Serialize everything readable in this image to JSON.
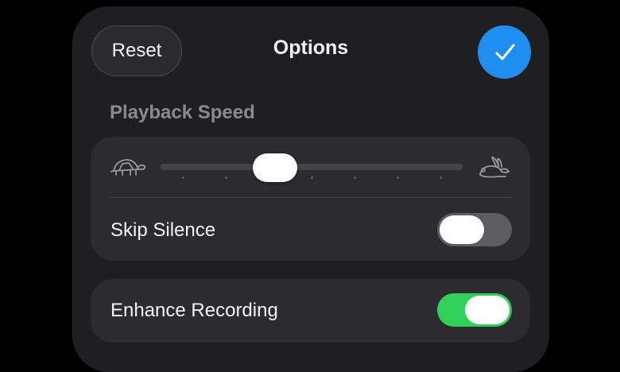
{
  "header": {
    "reset_label": "Reset",
    "title": "Options",
    "confirm_icon": "checkmark-icon",
    "confirm_color": "#1e8ff0"
  },
  "playback": {
    "section_label": "Playback Speed",
    "slow_icon": "tortoise-icon",
    "fast_icon": "hare-icon",
    "speed_stops": 7,
    "selected_stop": 2
  },
  "skip_silence": {
    "label": "Skip Silence",
    "enabled": false
  },
  "enhance_recording": {
    "label": "Enhance Recording",
    "enabled": true,
    "on_color": "#30d158"
  }
}
